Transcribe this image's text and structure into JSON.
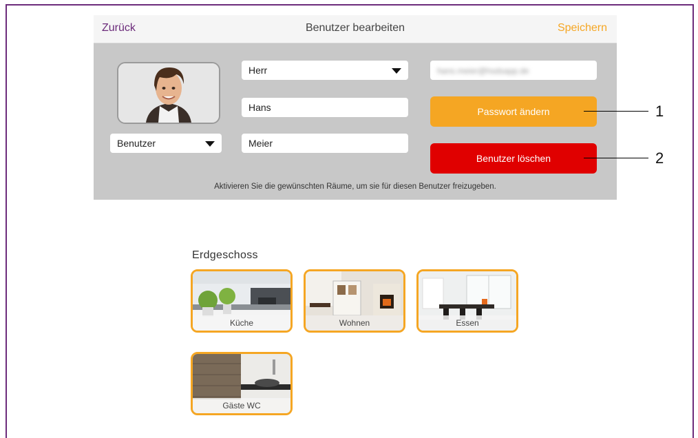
{
  "navbar": {
    "back_label": "Zurück",
    "title": "Benutzer bearbeiten",
    "save_label": "Speichern"
  },
  "form": {
    "salutation": "Herr",
    "first_name": "Hans",
    "last_name": "Meier",
    "role": "Benutzer",
    "email": "hans.meier@hsdsapp.de",
    "change_password_label": "Passwort ändern",
    "delete_user_label": "Benutzer löschen",
    "hint": "Aktivieren Sie die gewünschten Räume, um sie für diesen Benutzer freizugeben."
  },
  "callouts": [
    "1",
    "2"
  ],
  "floor": {
    "title": "Erdgeschoss",
    "rooms": [
      {
        "label": "Küche"
      },
      {
        "label": "Wohnen"
      },
      {
        "label": "Essen"
      },
      {
        "label": "Gäste WC"
      }
    ]
  },
  "colors": {
    "accent_orange": "#f5a623",
    "danger_red": "#e00000",
    "nav_purple": "#6b2a7a",
    "panel_gray": "#c8c8c8"
  }
}
